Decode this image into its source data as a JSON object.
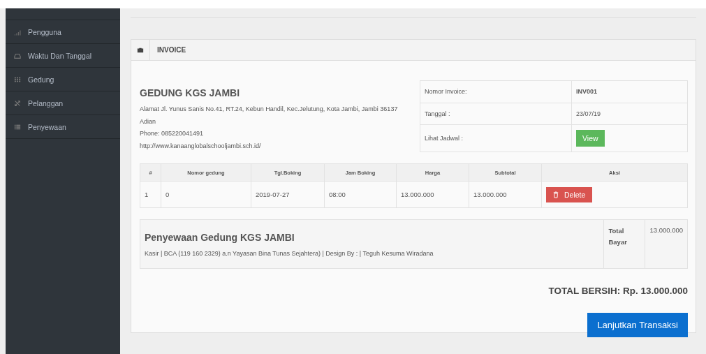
{
  "sidebar": {
    "items": [
      {
        "label": "Pengguna",
        "selected": false
      },
      {
        "label": "Waktu Dan Tanggal",
        "selected": false
      },
      {
        "label": "Gedung",
        "selected": false
      },
      {
        "label": "Pelanggan",
        "selected": false
      },
      {
        "label": "Penyewaan",
        "selected": false
      }
    ]
  },
  "panel": {
    "title": "INVOICE"
  },
  "company": {
    "name": "GEDUNG KGS JAMBI",
    "address": "Alamat Jl. Yunus Sanis No.41, RT.24, Kebun Handil, Kec.Jelutung, Kota Jambi, Jambi 36137",
    "line2": "Adian",
    "phone": "Phone: 085220041491",
    "website": "http://www.kanaanglobalschooljambi.sch.id/"
  },
  "info": {
    "invoice_label": "Nomor Invoice:",
    "invoice_value": "INV001",
    "date_label": "Tanggal :",
    "date_value": "23/07/19",
    "schedule_label": "Lihat Jadwal :",
    "view_button": "View"
  },
  "table": {
    "columns": [
      "#",
      "Nomor gedung",
      "Tgl.Boking",
      "Jam Boking",
      "Harga",
      "Subtotal",
      "Aksi"
    ],
    "rows": [
      {
        "cells": [
          "1",
          "0",
          "2019-07-27",
          "08:00",
          "13.000.000",
          "13.000.000"
        ],
        "action": "Delete"
      }
    ]
  },
  "summary": {
    "title": "Penyewaan Gedung KGS JAMBI",
    "note": "Kasir | BCA (119 160 2329) a.n Yayasan Bina Tunas Sejahtera) | Design By : | Teguh Kesuma Wiradana",
    "total_label": "Total Bayar",
    "total_value": "13.000.000"
  },
  "grand_total": "TOTAL BERSIH: Rp. 13.000.000",
  "continue_button": "Lanjutkan Transaksi"
}
